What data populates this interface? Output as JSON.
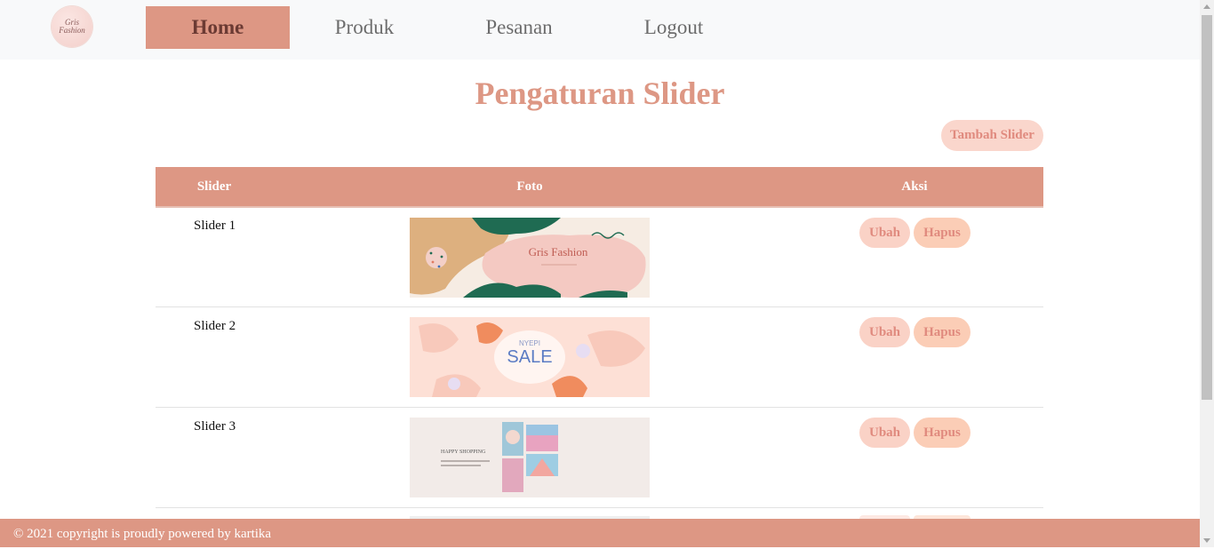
{
  "brand": {
    "logo_text": "Gris Fashion"
  },
  "nav": {
    "home": "Home",
    "produk": "Produk",
    "pesanan": "Pesanan",
    "logout": "Logout"
  },
  "page": {
    "title": "Pengaturan Slider",
    "add_button": "Tambah Slider"
  },
  "table": {
    "headers": {
      "slider": "Slider",
      "foto": "Foto",
      "aksi": "Aksi"
    },
    "rows": [
      {
        "name": "Slider 1",
        "banner_text": "Gris Fashion",
        "edit": "Ubah",
        "delete": "Hapus"
      },
      {
        "name": "Slider 2",
        "banner_text": "NYEPI SALE",
        "edit": "Ubah",
        "delete": "Hapus"
      },
      {
        "name": "Slider 3",
        "banner_text": "HAPPY SHOPPING",
        "edit": "Ubah",
        "delete": "Hapus"
      }
    ]
  },
  "footer": {
    "text": "© 2021 copyright is proudly powered by kartika"
  },
  "colors": {
    "accent": "#dd9784",
    "title": "#dd9784",
    "button_bg": "#fad2c6",
    "button_text": "#e08a7e",
    "nav_bg": "#f8f9fa"
  }
}
